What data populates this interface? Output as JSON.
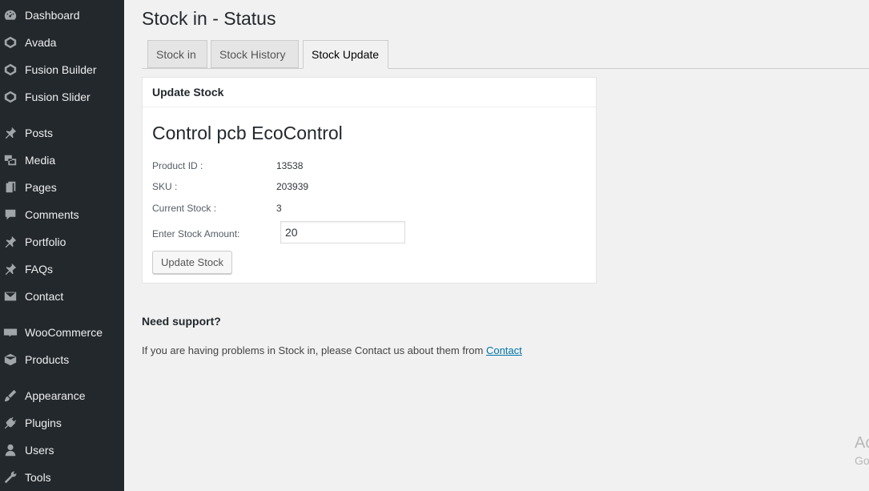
{
  "sidebar": {
    "items": [
      {
        "label": "Dashboard",
        "icon": "dashboard-icon"
      },
      {
        "label": "Avada",
        "icon": "avada-icon"
      },
      {
        "label": "Fusion Builder",
        "icon": "fusion-builder-icon"
      },
      {
        "label": "Fusion Slider",
        "icon": "fusion-slider-icon"
      },
      {
        "label": "Posts",
        "icon": "pin-icon"
      },
      {
        "label": "Media",
        "icon": "media-icon"
      },
      {
        "label": "Pages",
        "icon": "pages-icon"
      },
      {
        "label": "Comments",
        "icon": "comment-icon"
      },
      {
        "label": "Portfolio",
        "icon": "pin-icon"
      },
      {
        "label": "FAQs",
        "icon": "pin-icon"
      },
      {
        "label": "Contact",
        "icon": "mail-icon"
      },
      {
        "label": "WooCommerce",
        "icon": "woocommerce-icon"
      },
      {
        "label": "Products",
        "icon": "box-icon"
      },
      {
        "label": "Appearance",
        "icon": "brush-icon"
      },
      {
        "label": "Plugins",
        "icon": "plug-icon"
      },
      {
        "label": "Users",
        "icon": "user-icon"
      },
      {
        "label": "Tools",
        "icon": "wrench-icon"
      }
    ]
  },
  "page": {
    "title": "Stock in - Status"
  },
  "tabs": [
    {
      "label": "Stock in",
      "active": false
    },
    {
      "label": "Stock History",
      "active": false
    },
    {
      "label": "Stock Update",
      "active": true
    }
  ],
  "panel": {
    "header": "Update Stock",
    "product_name": "Control pcb EcoControl",
    "fields": [
      {
        "label": "Product ID :",
        "value": "13538"
      },
      {
        "label": "SKU :",
        "value": "203939"
      },
      {
        "label": "Current Stock :",
        "value": "3"
      }
    ],
    "input_label": "Enter Stock Amount:",
    "input_value": "20",
    "button_label": "Update Stock"
  },
  "support": {
    "title": "Need support?",
    "text": "If you are having problems in Stock in, please Contact us about them from ",
    "link": "Contact"
  },
  "watermark": {
    "line1": "Ac",
    "line2": "Go"
  },
  "colors": {
    "sidebar_bg": "#23282d",
    "page_bg": "#f1f1f1",
    "link": "#0073aa"
  }
}
